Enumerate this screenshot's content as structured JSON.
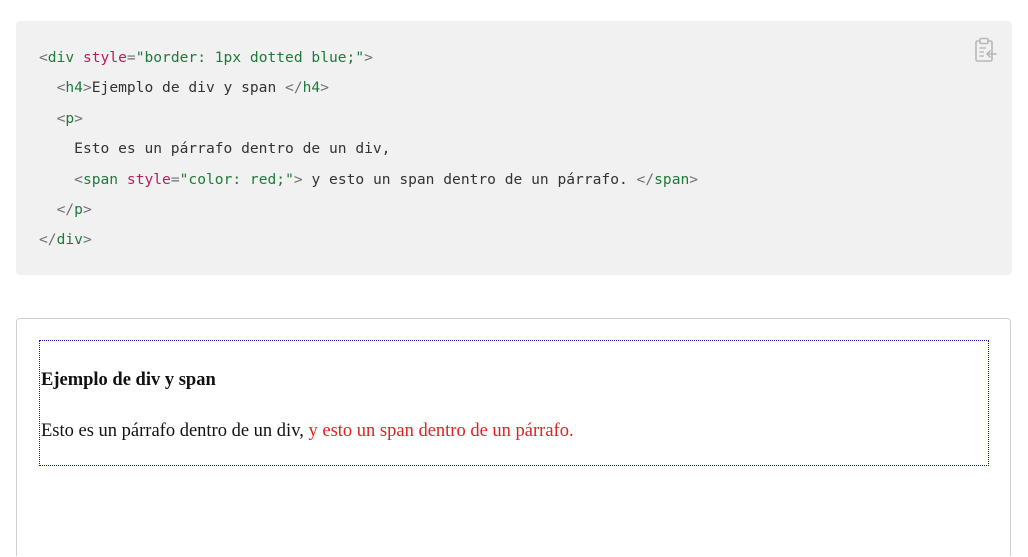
{
  "code_example": {
    "lines": [
      {
        "indent": "",
        "parts": [
          {
            "t": "<",
            "k": "punct"
          },
          {
            "t": "div",
            "k": "tag"
          },
          {
            "t": " ",
            "k": "text"
          },
          {
            "t": "style",
            "k": "attr"
          },
          {
            "t": "=",
            "k": "punct"
          },
          {
            "t": "\"border: 1px dotted blue;\"",
            "k": "val"
          },
          {
            "t": ">",
            "k": "punct"
          }
        ]
      },
      {
        "indent": "  ",
        "parts": [
          {
            "t": "<",
            "k": "punct"
          },
          {
            "t": "h4",
            "k": "tag"
          },
          {
            "t": ">",
            "k": "punct"
          },
          {
            "t": "Ejemplo de div y span ",
            "k": "text"
          },
          {
            "t": "</",
            "k": "punct"
          },
          {
            "t": "h4",
            "k": "tag"
          },
          {
            "t": ">",
            "k": "punct"
          }
        ]
      },
      {
        "indent": "  ",
        "parts": [
          {
            "t": "<",
            "k": "punct"
          },
          {
            "t": "p",
            "k": "tag"
          },
          {
            "t": ">",
            "k": "punct"
          }
        ]
      },
      {
        "indent": "    ",
        "parts": [
          {
            "t": "Esto es un párrafo dentro de un div,",
            "k": "text"
          }
        ]
      },
      {
        "indent": "    ",
        "parts": [
          {
            "t": "<",
            "k": "punct"
          },
          {
            "t": "span",
            "k": "tag"
          },
          {
            "t": " ",
            "k": "text"
          },
          {
            "t": "style",
            "k": "attr"
          },
          {
            "t": "=",
            "k": "punct"
          },
          {
            "t": "\"color: red;\"",
            "k": "val"
          },
          {
            "t": ">",
            "k": "punct"
          },
          {
            "t": " y esto un span dentro de un párrafo. ",
            "k": "text"
          },
          {
            "t": "</",
            "k": "punct"
          },
          {
            "t": "span",
            "k": "tag"
          },
          {
            "t": ">",
            "k": "punct"
          }
        ]
      },
      {
        "indent": "  ",
        "parts": [
          {
            "t": "</",
            "k": "punct"
          },
          {
            "t": "p",
            "k": "tag"
          },
          {
            "t": ">",
            "k": "punct"
          }
        ]
      },
      {
        "indent": "",
        "parts": [
          {
            "t": "</",
            "k": "punct"
          },
          {
            "t": "div",
            "k": "tag"
          },
          {
            "t": ">",
            "k": "punct"
          }
        ]
      }
    ],
    "copy_icon": "clipboard-copy-icon"
  },
  "result": {
    "heading": "Ejemplo de div y span",
    "paragraph_text": "Esto es un párrafo dentro de un div, ",
    "span_text": "y esto un span dentro de un párrafo."
  },
  "colors": {
    "code_background": "#f2f1f1",
    "tag": "#1f7a3a",
    "attribute": "#c2185b",
    "span_text": "#e32020",
    "div_border": "#1a1aa8"
  }
}
